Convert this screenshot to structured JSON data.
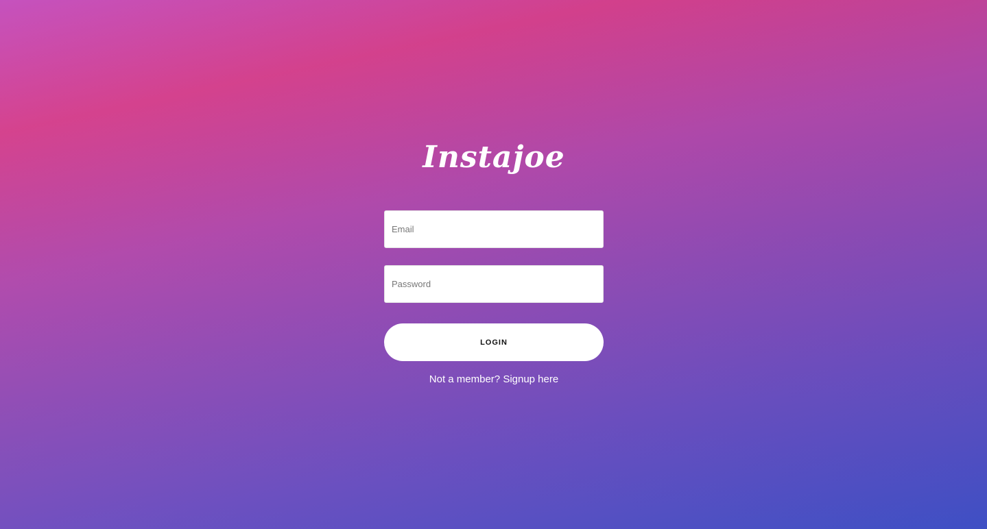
{
  "brand": {
    "name": "Instajoe"
  },
  "form": {
    "email_placeholder": "Email",
    "password_placeholder": "Password",
    "login_label": "LOGIN"
  },
  "signup": {
    "prompt": "Not a member?",
    "link_label": "Signup here"
  },
  "colors": {
    "gradient_top": "#c44fbd",
    "gradient_mid": "#8f4bb5",
    "gradient_bottom": "#3f51c8",
    "button_bg": "#ffffff"
  }
}
